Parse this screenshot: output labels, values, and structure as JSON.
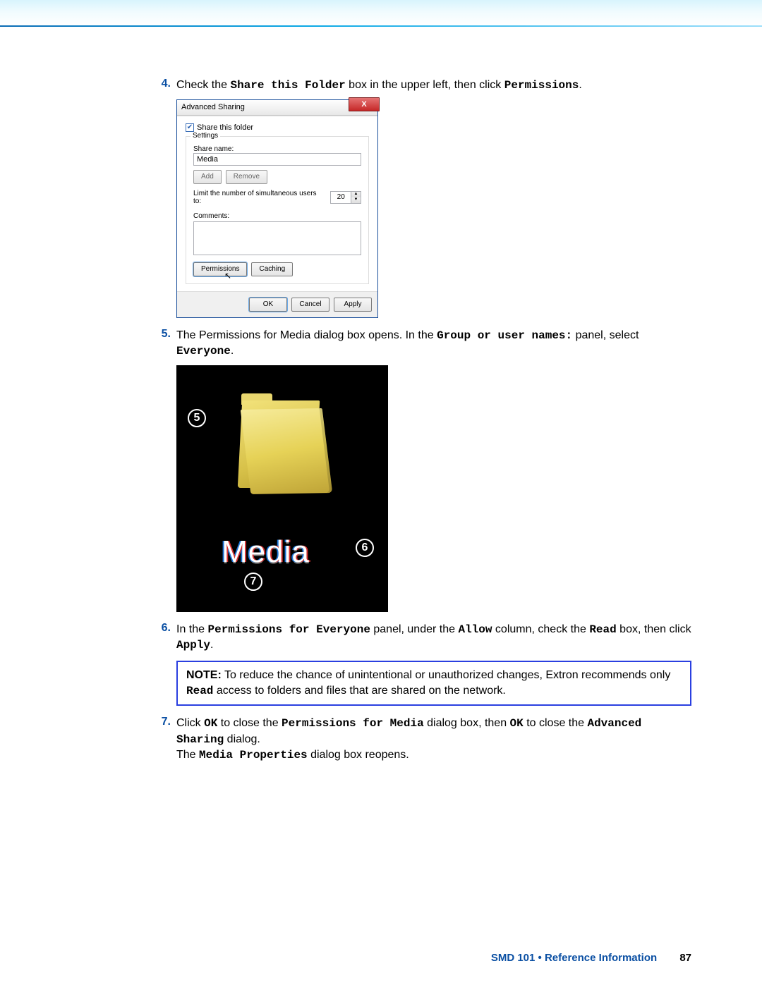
{
  "steps": {
    "s4": {
      "num": "4.",
      "pre": "Check the ",
      "code1": "Share this Folder",
      "mid": " box in the upper left, then click ",
      "code2": "Permissions",
      "post": "."
    },
    "s5": {
      "num": "5.",
      "pre": "The Permissions for Media dialog box opens. In the ",
      "code1": "Group or user names:",
      "mid": " panel, select ",
      "code2": "Everyone",
      "post": "."
    },
    "s6": {
      "num": "6.",
      "pre": "In the ",
      "code1": "Permissions for Everyone",
      "mid1": " panel, under the ",
      "code2": "Allow",
      "mid2": " column, check the ",
      "code3": "Read",
      "mid3": " box, then click ",
      "code4": "Apply",
      "post": "."
    },
    "s7": {
      "num": "7.",
      "pre": "Click ",
      "code1": "OK",
      "mid1": " to close the ",
      "code2": "Permissions for Media",
      "mid2": " dialog box, then ",
      "code3": "OK",
      "mid3": " to close the ",
      "code4": "Advanced Sharing",
      "post1": " dialog.",
      "line2a": "The ",
      "code5": "Media Properties",
      "line2b": " dialog box reopens."
    }
  },
  "dialog": {
    "title": "Advanced Sharing",
    "share_chk": "Share this folder",
    "settings": "Settings",
    "share_name_label": "Share name:",
    "share_name_value": "Media",
    "add": "Add",
    "remove": "Remove",
    "limit_label": "Limit the number of simultaneous users to:",
    "limit_value": "20",
    "comments_label": "Comments:",
    "permissions": "Permissions",
    "caching": "Caching",
    "ok": "OK",
    "cancel": "Cancel",
    "apply": "Apply",
    "close_x": "X"
  },
  "figure": {
    "c5": "5",
    "c6": "6",
    "c7": "7",
    "media_label": "Media"
  },
  "note": {
    "prefix": "NOTE:",
    "t1": " To reduce the chance of unintentional or unauthorized changes, Extron recommends only ",
    "code": "Read",
    "t2": " access to folders and files that are shared on the network."
  },
  "footer": {
    "doc": "SMD 101 • Reference Information",
    "page": "87"
  }
}
